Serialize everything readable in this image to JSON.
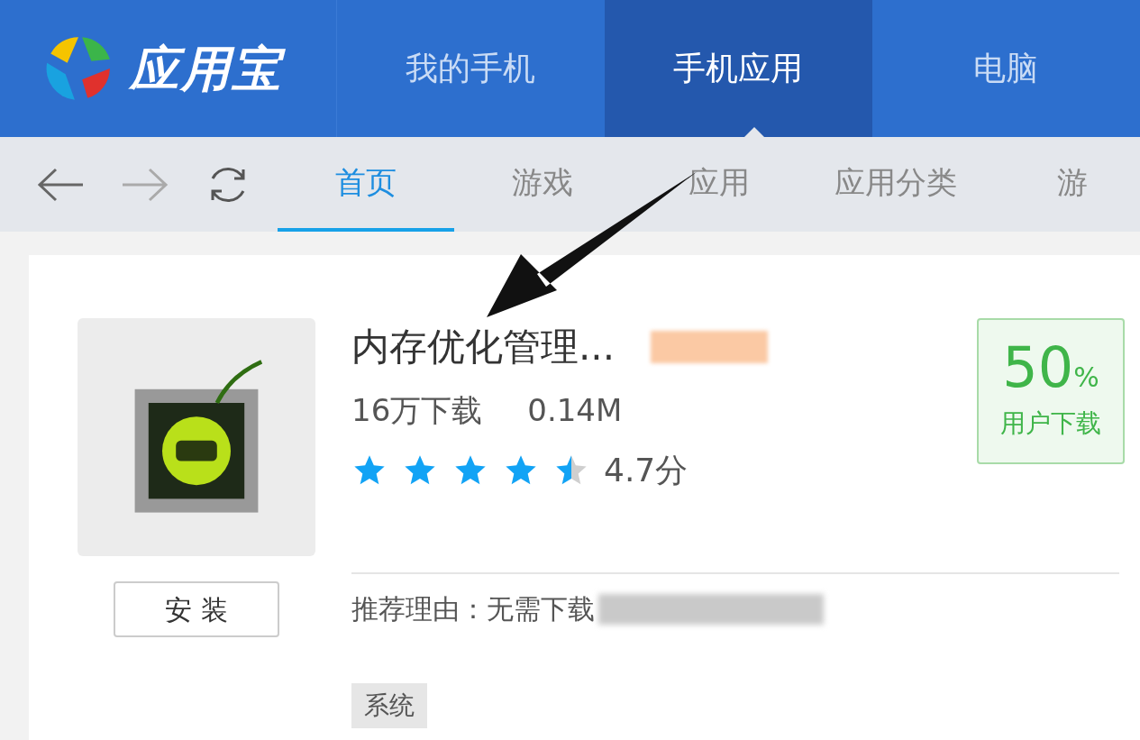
{
  "header": {
    "logo": "应用宝",
    "tabs": [
      {
        "label": "我的手机",
        "selected": false
      },
      {
        "label": "手机应用",
        "selected": true
      },
      {
        "label": "电脑",
        "selected": false
      }
    ]
  },
  "nav": {
    "tabs": [
      {
        "label": "首页",
        "selected": true
      },
      {
        "label": "游戏",
        "selected": false
      },
      {
        "label": "应用",
        "selected": false
      },
      {
        "label": "应用分类",
        "selected": false
      },
      {
        "label": "游",
        "selected": false
      }
    ]
  },
  "app": {
    "name": "内存优化管理...",
    "downloads": "16万下载",
    "size": "0.14M",
    "stars": 4.5,
    "score": "4.7分",
    "install": "安 装",
    "percent": "50",
    "percent_unit": "%",
    "percent_label": "用户下载",
    "reason": "推荐理由：无需下载",
    "tag": "系统"
  }
}
